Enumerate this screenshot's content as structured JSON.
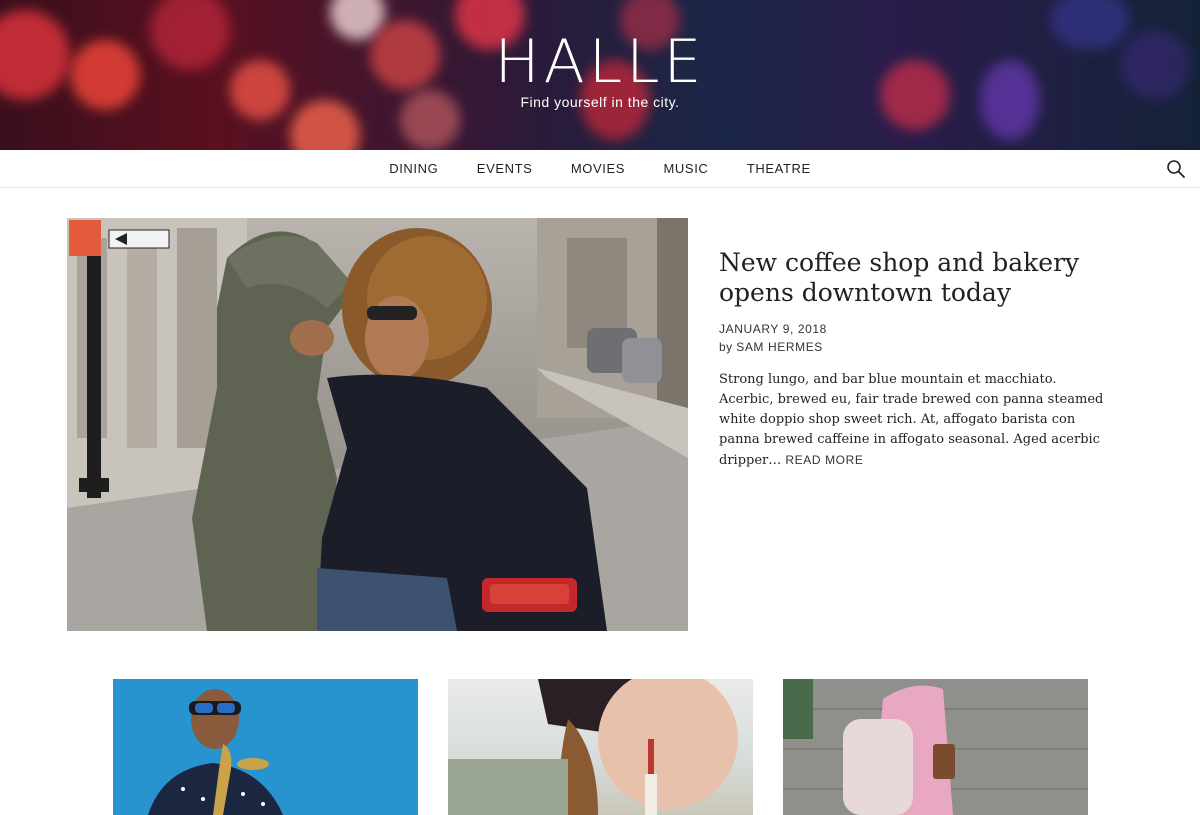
{
  "site": {
    "title": "HALLE",
    "tagline": "Find yourself in the city."
  },
  "nav": {
    "items": [
      {
        "label": "DINING"
      },
      {
        "label": "EVENTS"
      },
      {
        "label": "MOVIES"
      },
      {
        "label": "MUSIC"
      },
      {
        "label": "THEATRE"
      }
    ],
    "search_icon": "search-icon"
  },
  "featured_post": {
    "title": "New coffee shop and bakery opens downtown today",
    "date": "JANUARY 9, 2018",
    "byline_prefix": "by",
    "author": "SAM HERMES",
    "excerpt": "Strong lungo, and bar blue mountain et macchiato. Acerbic, brewed eu, fair trade brewed con panna steamed white doppio shop sweet rich. At, affogato barista con panna brewed caffeine in affogato seasonal. Aged acerbic dripper…",
    "read_more": "READ MORE"
  },
  "colors": {
    "text": "#222222",
    "nav_border": "#ececec",
    "thumb_1_bg": "#2793cf"
  }
}
